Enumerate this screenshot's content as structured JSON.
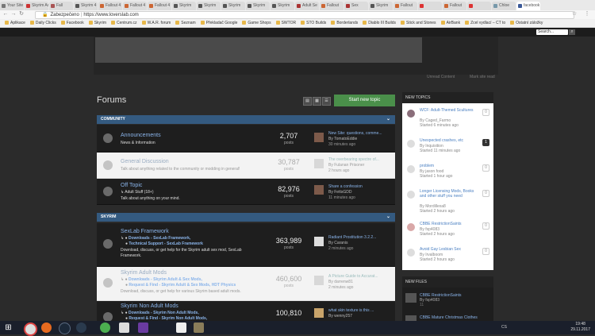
{
  "browser": {
    "tabs": [
      "Your Site",
      "Skyrim Adul",
      "Fall",
      "Skyrim 4",
      "Fallout 4",
      "Fallout 4",
      "Fallout 4",
      "Skyrim",
      "Skyrim",
      "Skyrim",
      "Skyrim",
      "Skyrim",
      "Adult Se",
      "Fallout",
      "Sex",
      "Skyrim",
      "Fallout",
      "",
      "Fallout",
      "",
      "Chloe",
      "facebook"
    ],
    "address": {
      "secure_label": "Zabezpečeno",
      "url": "https://www.loverslab.com"
    },
    "bookmarks": [
      "Aplikace",
      "Daily Clicks",
      "Facebook",
      "Skyrim",
      "Centrum.cz",
      "W.A.R. forum",
      "Seznam",
      "Překladač Google",
      "Game Shops",
      "SWTOR",
      "STO Builds",
      "Borderlands",
      "Diablo III Builds",
      "Stick and Stones",
      "AirBank",
      "Zcel vydlací – CT to",
      "Ostatní záložky"
    ]
  },
  "site": {
    "search_placeholder": "Search...",
    "search_icon": "magnifier-icon",
    "subnav_left": "",
    "subnav_right": [
      "Unread Content",
      "Mark site read"
    ],
    "page_title": "Forums",
    "start_topic": "Start new topic"
  },
  "categories": [
    {
      "name": "COMMUNITY",
      "forums": [
        {
          "title": "Announcements",
          "desc": "News & Information",
          "sub": "",
          "count": "2,707",
          "count_label": "posts",
          "last_title": "New Site: questions, comme...",
          "last_by": "By TomatoEddie",
          "last_time": "30 minutes ago",
          "light": false
        },
        {
          "title": "General Discussion",
          "desc": "Talk about anything related to the community or modding in general!",
          "sub": "",
          "count": "30,787",
          "count_label": "posts",
          "last_title": "The overbearing spectre of...",
          "last_by": "By Fulanan Prisoner",
          "last_time": "2 hours ago",
          "light": true
        },
        {
          "title": "Off Topic",
          "desc": "Talk about anything on your mind.",
          "sub": "↳ Adult Stuff (18+)",
          "count": "82,976",
          "count_label": "posts",
          "last_title": "Share a confession",
          "last_by": "By FettsGDD",
          "last_time": "11 minutes ago",
          "light": false
        }
      ]
    },
    {
      "name": "SKYRIM",
      "forums": [
        {
          "title": "SexLab Framework",
          "desc": "Download, discuss, or get help for the Skyrim adult sex mod, SexLab Framework.",
          "sub1": "Downloads - SexLab Framework,",
          "sub2": "Technical Support - SexLab Framework",
          "count": "363,989",
          "count_label": "posts",
          "last_title": "Radiant Prostitution 3.2.2...",
          "last_by": "By Caranis",
          "last_time": "2 minutes ago",
          "light": false
        },
        {
          "title": "Skyrim Adult Mods",
          "desc": "Download, discuss, or get help for various Skyrim based adult mods.",
          "sub1": "Downloads - Skyrim Adult & Sex Mods,",
          "sub2": "Request & Find - Skyrim Adult & Sex Mods,  HDT Physics",
          "count": "460,600",
          "count_label": "posts",
          "last_title": "A Picture Guide to Accurat...",
          "last_by": "By darrenw81",
          "last_time": "2 minutes ago",
          "light": true
        },
        {
          "title": "Skyrim Non Adult Mods",
          "desc": "",
          "sub1": "Downloads - Skyrim Non Adult Mods,",
          "sub2": "Request & Find - Skyrim Non Adult Mods,",
          "count": "100,810",
          "count_label": "posts",
          "last_title": "what skin texture is this ...",
          "last_by": "By wenny257",
          "last_time": "",
          "light": false
        }
      ]
    }
  ],
  "sidebar": {
    "new_topics_title": "NEW TOPICS",
    "topics": [
      {
        "title": "WCF: Adult-Themed Scultures",
        "by": "By Caged_Farmo",
        "time": "Started 6 minutes ago",
        "count": "0"
      },
      {
        "title": "Unexpected crashes, etc",
        "by": "By Inquisition",
        "time": "Started 11 minutes ago",
        "count": "1"
      },
      {
        "title": "problem",
        "by": "By jason food",
        "time": "Started 1 hour ago",
        "count": "0"
      },
      {
        "title": "Longer Licensing Mods, Books and other stuff you need",
        "by": "By Mordillexa8",
        "time": "Started 2 hours ago",
        "count": "0"
      },
      {
        "title": "CBBE RestrictionSaints",
        "by": "By fsp4083",
        "time": "Started 2 hours ago",
        "count": "0"
      },
      {
        "title": "Avoid Gay Lesbian Sex",
        "by": "By Irvalboom",
        "time": "Started 2 hours ago",
        "count": "0"
      }
    ],
    "new_files_title": "NEW FILES",
    "files": [
      {
        "title": "CBBE RestrictionSaints",
        "by": "By fsp4083",
        "meta": "11"
      },
      {
        "title": "CBBE Mature Christmas Clothes",
        "by": "",
        "meta": ""
      }
    ]
  },
  "taskbar": {
    "lang": "CS",
    "time": "19:48",
    "date": "29.11.2017",
    "apps": [
      "windows-start-icon",
      "chrome-icon",
      "firefox-icon",
      "steam-icon",
      "steam-icon-2",
      "utorrent-icon",
      "download-icon",
      "visual-studio-icon",
      "notepad-icon",
      "game-icon"
    ]
  }
}
